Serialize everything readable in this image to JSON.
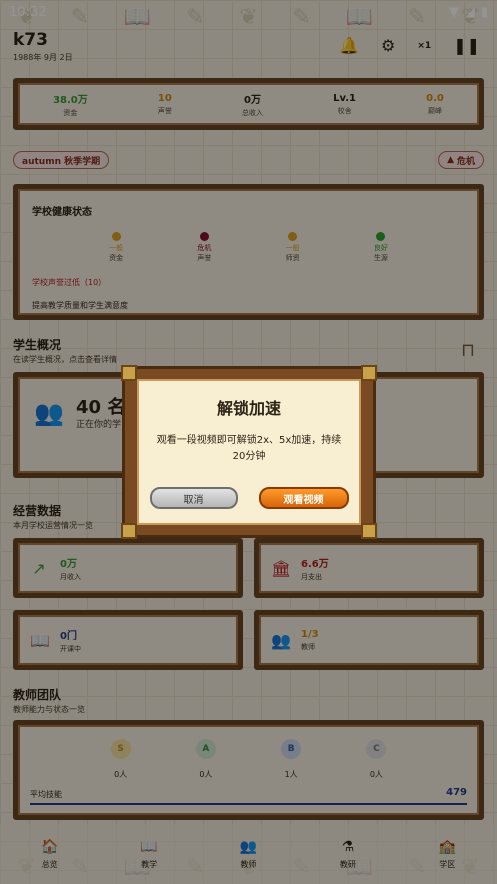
{
  "status_bar": {
    "time": "10:32"
  },
  "header": {
    "school_name": "k73",
    "date": "1988年 9月 2日",
    "speed": "×1"
  },
  "stats": [
    {
      "value": "38.0万",
      "label": "资金",
      "color": "#3a9a3a"
    },
    {
      "value": "10",
      "label": "声誉",
      "color": "#d08a10"
    },
    {
      "value": "0万",
      "label": "总收入",
      "color": "#2e2418"
    },
    {
      "value": "Lv.1",
      "label": "校舍",
      "color": "#2e2418"
    },
    {
      "value": "0.0",
      "label": "巅峰",
      "color": "#d08a10"
    }
  ],
  "semester_tag": "autumn 秋季学期",
  "crisis_tag": "危机",
  "health": {
    "title": "学校健康状态",
    "indicators": [
      {
        "status": "一般",
        "label": "资金",
        "color": "#e0a020"
      },
      {
        "status": "危机",
        "label": "声誉",
        "color": "#8a1030"
      },
      {
        "status": "一般",
        "label": "师资",
        "color": "#e0a020"
      },
      {
        "status": "良好",
        "label": "生源",
        "color": "#30a030"
      }
    ],
    "warning": "学校声誉过低（10）",
    "advice": "提高教学质量和学生满意度"
  },
  "students": {
    "title": "学生概况",
    "subtitle": "在读学生概况，点击查看详情",
    "count": "40 名",
    "count_sub": "正在你的学"
  },
  "business": {
    "title": "经营数据",
    "subtitle": "本月学校运营情况一览",
    "cards": [
      {
        "value": "0万",
        "label": "月收入",
        "color": "#3a9a3a",
        "icon": "trend-up"
      },
      {
        "value": "6.6万",
        "label": "月支出",
        "color": "#b82020",
        "icon": "bank"
      },
      {
        "value": "0门",
        "label": "开课中",
        "color": "#2a3c8a",
        "icon": "book"
      },
      {
        "value": "1/3",
        "label": "教师",
        "color": "#d08a10",
        "icon": "people"
      }
    ]
  },
  "teachers": {
    "title": "教师团队",
    "subtitle": "教师能力与状态一览",
    "grades": [
      {
        "grade": "S",
        "count": "0人",
        "bg": "#f5e2a0",
        "fg": "#c09020"
      },
      {
        "grade": "A",
        "count": "0人",
        "bg": "#cfe8cf",
        "fg": "#3a8a3a"
      },
      {
        "grade": "B",
        "count": "1人",
        "bg": "#cdd8f0",
        "fg": "#3a5aa0"
      },
      {
        "grade": "C",
        "count": "0人",
        "bg": "#e0e0e0",
        "fg": "#777"
      }
    ],
    "avg_label": "平均技能",
    "avg_value": "479"
  },
  "nav": [
    "总览",
    "教学",
    "教师",
    "教研",
    "学区"
  ],
  "dialog": {
    "title": "解锁加速",
    "message": "观看一段视频即可解锁2x、5x加速，持续20分钟",
    "cancel": "取消",
    "confirm": "观看视频"
  }
}
